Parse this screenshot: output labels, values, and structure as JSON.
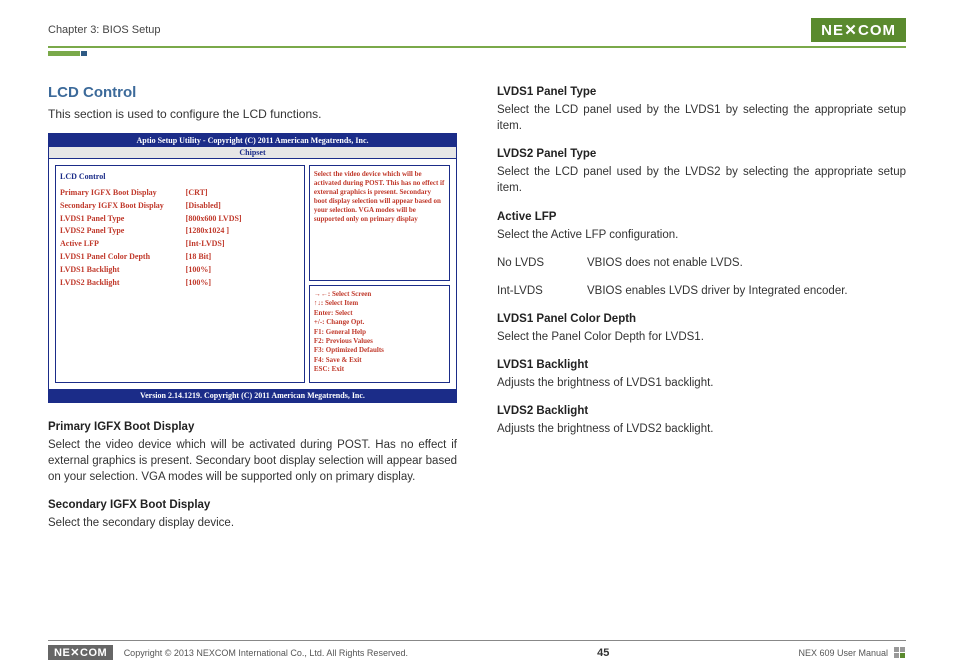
{
  "header": {
    "chapter": "Chapter 3: BIOS Setup",
    "brand": "NE",
    "brand2": "COM"
  },
  "left": {
    "title": "LCD Control",
    "intro": "This section is used to configure the LCD functions.",
    "bios": {
      "topbar": "Aptio Setup Utility - Copyright (C) 2011 American Megatrends, Inc.",
      "tabbar": "Chipset",
      "section": "LCD Control",
      "rows": [
        {
          "k": "Primary IGFX Boot Display",
          "v": "[CRT]"
        },
        {
          "k": "Secondary IGFX Boot Display",
          "v": "[Disabled]"
        },
        {
          "k": "LVDS1 Panel Type",
          "v": "[800x600      LVDS]"
        },
        {
          "k": "LVDS2 Panel Type",
          "v": "[1280x1024  ]"
        },
        {
          "k": "Active LFP",
          "v": "[Int-LVDS]"
        },
        {
          "k": "LVDS1 Panel Color Depth",
          "v": "[18 Bit]"
        },
        {
          "k": "LVDS1 Backlight",
          "v": "[100%]"
        },
        {
          "k": "LVDS2 Backlight",
          "v": "[100%]"
        }
      ],
      "help": "Select the video device which will be activated during POST. This has no effect if external graphics is present. Secondary boot display selection will appear based on your selection. VGA modes will be supported only on primary display",
      "keys": [
        "→←: Select Screen",
        "↑↓: Select Item",
        "Enter: Select",
        "+/-: Change Opt.",
        "F1: General Help",
        "F2: Previous Values",
        "F3: Optimized Defaults",
        "F4: Save & Exit",
        "ESC: Exit"
      ],
      "footer": "Version 2.14.1219. Copyright (C) 2011 American Megatrends, Inc."
    },
    "d1": {
      "h": "Primary IGFX Boot Display",
      "p": "Select the video device which will be activated during POST. Has no effect if external graphics is present. Secondary boot display selection will appear based on your selection. VGA modes will be supported only on primary display."
    },
    "d2": {
      "h": "Secondary IGFX Boot Display",
      "p": "Select the secondary display device."
    }
  },
  "right": {
    "r1": {
      "h": "LVDS1 Panel Type",
      "p": "Select the LCD panel used by the LVDS1 by selecting the appropriate setup item."
    },
    "r2": {
      "h": "LVDS2 Panel Type",
      "p": "Select the LCD panel used by the LVDS2 by selecting the appropriate setup item."
    },
    "r3": {
      "h": "Active LFP",
      "p": "Select the Active LFP configuration."
    },
    "r3a": {
      "t": "No LVDS",
      "d": "VBIOS does not enable LVDS."
    },
    "r3b": {
      "t": "Int-LVDS",
      "d": "VBIOS enables LVDS driver by Integrated encoder."
    },
    "r4": {
      "h": "LVDS1 Panel Color Depth",
      "p": "Select the Panel Color Depth for LVDS1."
    },
    "r5": {
      "h": "LVDS1 Backlight",
      "p": "Adjusts the brightness of LVDS1 backlight."
    },
    "r6": {
      "h": "LVDS2 Backlight",
      "p": "Adjusts the brightness of LVDS2 backlight."
    }
  },
  "footer": {
    "copyright": "Copyright © 2013 NEXCOM International Co., Ltd. All Rights Reserved.",
    "page": "45",
    "doc": "NEX 609 User Manual",
    "brand": "NE",
    "brand2": "COM"
  }
}
